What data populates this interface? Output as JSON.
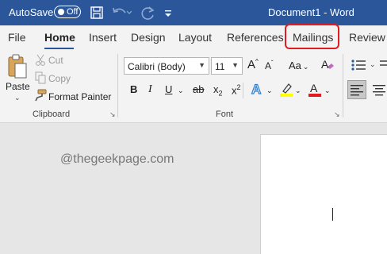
{
  "titlebar": {
    "autosave_label": "AutoSave",
    "autosave_state": "Off",
    "document_title": "Document1  -  Word",
    "background": "#2b579a"
  },
  "tabs": [
    {
      "label": "File"
    },
    {
      "label": "Home",
      "active": true
    },
    {
      "label": "Insert"
    },
    {
      "label": "Design"
    },
    {
      "label": "Layout"
    },
    {
      "label": "References"
    },
    {
      "label": "Mailings",
      "highlighted": true
    },
    {
      "label": "Review"
    }
  ],
  "clipboard": {
    "paste_label": "Paste",
    "cut_label": "Cut",
    "copy_label": "Copy",
    "format_painter_label": "Format Painter",
    "group_label": "Clipboard"
  },
  "font": {
    "font_name": "Calibri (Body)",
    "font_size": "11",
    "case_label": "Aa",
    "bold": "B",
    "italic": "I",
    "underline": "U",
    "strikethrough": "ab",
    "subscript": "x",
    "superscript": "x",
    "subscript_mark": "2",
    "superscript_mark": "2",
    "font_color_letter": "A",
    "group_label": "Font",
    "highlight_color": "#ffff00",
    "font_color": "#e21b23"
  },
  "document": {
    "watermark": "@thegeekpage.com"
  },
  "colors": {
    "highlight_box": "#e21b23",
    "accent": "#2b579a"
  },
  "icons": [
    "save-icon",
    "undo-icon",
    "redo-icon",
    "customize-qat-icon",
    "paste-icon",
    "cut-icon",
    "copy-icon",
    "format-painter-icon",
    "grow-font-icon",
    "shrink-font-icon",
    "clear-formatting-icon",
    "text-effects-icon",
    "highlight-icon",
    "font-color-icon",
    "bullets-icon",
    "align-left-icon",
    "dialog-launcher-icon"
  ]
}
